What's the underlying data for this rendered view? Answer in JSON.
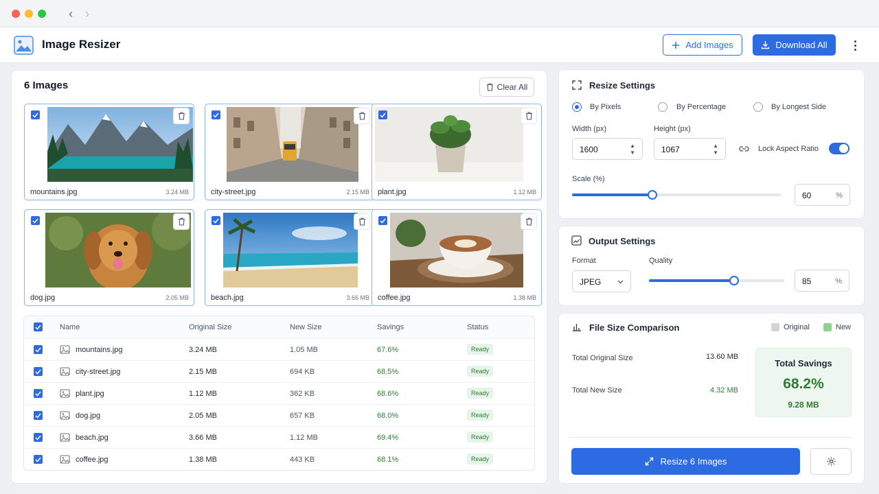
{
  "app": {
    "title": "Image Resizer"
  },
  "header": {
    "add_images": "Add Images",
    "download_all": "Download All"
  },
  "images": {
    "title": "6 Images",
    "clear_all": "Clear All",
    "cards": [
      {
        "name": "mountains.jpg",
        "size": "3.24 MB"
      },
      {
        "name": "city-street.jpg",
        "size": "2.15 MB"
      },
      {
        "name": "plant.jpg",
        "size": "1.12 MB"
      },
      {
        "name": "dog.jpg",
        "size": "2.05 MB"
      },
      {
        "name": "beach.jpg",
        "size": "3.66 MB"
      },
      {
        "name": "coffee.jpg",
        "size": "1.38 MB"
      }
    ]
  },
  "table": {
    "headers": {
      "name": "Name",
      "original": "Original Size",
      "new": "New Size",
      "savings": "Savings",
      "status": "Status"
    },
    "rows": [
      {
        "name": "mountains.jpg",
        "original": "3.24 MB",
        "new": "1.05 MB",
        "savings": "67.6%",
        "status": "Ready"
      },
      {
        "name": "city-street.jpg",
        "original": "2.15 MB",
        "new": "694 KB",
        "savings": "68.5%",
        "status": "Ready"
      },
      {
        "name": "plant.jpg",
        "original": "1.12 MB",
        "new": "362 KB",
        "savings": "68.6%",
        "status": "Ready"
      },
      {
        "name": "dog.jpg",
        "original": "2.05 MB",
        "new": "657 KB",
        "savings": "68.0%",
        "status": "Ready"
      },
      {
        "name": "beach.jpg",
        "original": "3.66 MB",
        "new": "1.12 MB",
        "savings": "69.4%",
        "status": "Ready"
      },
      {
        "name": "coffee.jpg",
        "original": "1.38 MB",
        "new": "443 KB",
        "savings": "68.1%",
        "status": "Ready"
      }
    ]
  },
  "resize": {
    "title": "Resize Settings",
    "modes": [
      "By Pixels",
      "By Percentage",
      "By Longest Side"
    ],
    "selected_mode": "By Pixels",
    "width_label": "Width (px)",
    "width_value": "1600",
    "height_label": "Height (px)",
    "height_value": "1067",
    "lock_label": "Lock Aspect Ratio",
    "lock_on": true,
    "scale_label": "Scale (%)",
    "scale_value": "60",
    "scale_unit": "%"
  },
  "output": {
    "title": "Output Settings",
    "format_label": "Format",
    "format_value": "JPEG",
    "quality_label": "Quality",
    "quality_value": "85",
    "quality_unit": "%"
  },
  "comparison": {
    "title": "File Size Comparison",
    "legend_original": "Original",
    "legend_new": "New",
    "total_original_label": "Total Original Size",
    "total_original_value": "13.60 MB",
    "total_new_label": "Total New Size",
    "total_new_value": "4.32 MB",
    "savings_title": "Total Savings",
    "savings_percent": "68.2%",
    "savings_amount": "9.28 MB"
  },
  "actions": {
    "resize_button": "Resize 6 Images"
  },
  "colors": {
    "accent": "#2d6be3",
    "success": "#2e7d32",
    "original_legend": "#d1d5db",
    "new_legend": "#8fd18f"
  },
  "icons": [
    "image-icon",
    "plus-icon",
    "download-icon",
    "more-vertical-icon",
    "trash-icon",
    "check-icon",
    "resize-icon",
    "output-icon",
    "chart-icon",
    "link-icon",
    "expand-icon",
    "gear-icon",
    "chevron-left-icon",
    "chevron-right-icon",
    "chevron-down-icon"
  ]
}
